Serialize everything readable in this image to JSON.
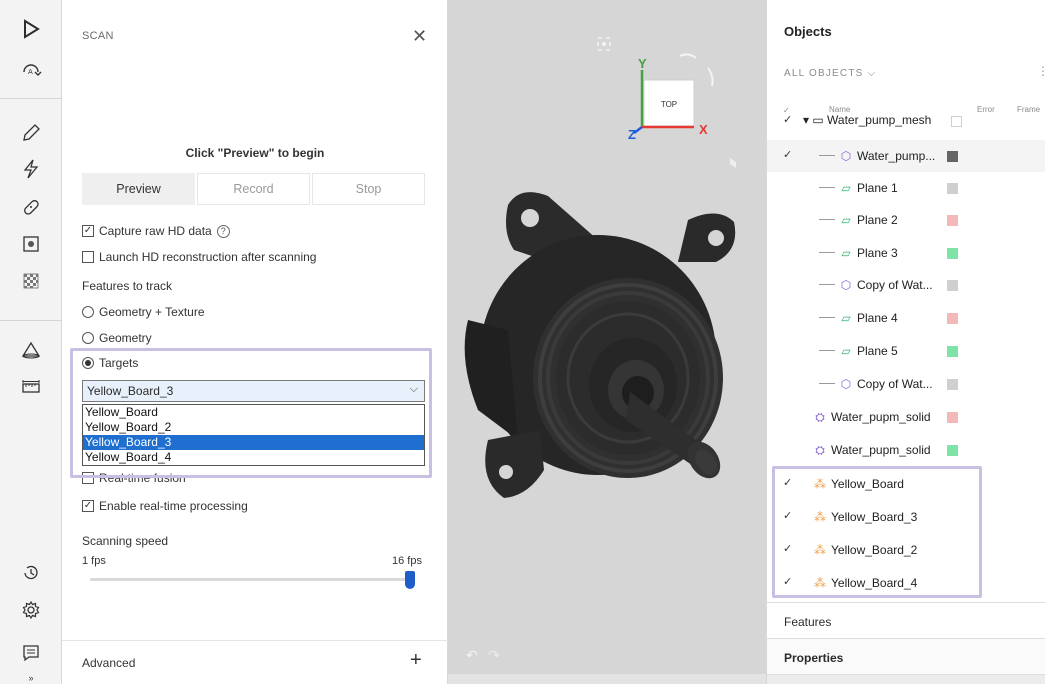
{
  "scan_panel": {
    "title": "SCAN",
    "hint": "Click \"Preview\" to begin",
    "tabs": [
      "Preview",
      "Record",
      "Stop"
    ],
    "capture_raw": "Capture raw HD data",
    "launch_hd": "Launch HD reconstruction after scanning",
    "features_label": "Features to track",
    "feature_options": [
      "Geometry + Texture",
      "Geometry",
      "Targets"
    ],
    "target_selected": "Yellow_Board_3",
    "target_options": [
      "Yellow_Board",
      "Yellow_Board_2",
      "Yellow_Board_3",
      "Yellow_Board_4"
    ],
    "realtime_fusion": "Real-time fusion",
    "realtime_processing": "Enable real-time processing",
    "speed_label": "Scanning speed",
    "speed_min": "1 fps",
    "speed_max": "16 fps",
    "speed_value_fraction": 1.0,
    "advanced": "Advanced"
  },
  "viewport": {
    "cube_face": "TOP",
    "axis_y": "Y",
    "axis_x": "X",
    "axis_z": "Z",
    "axis_colors": {
      "x": "#e53935",
      "y": "#43a047",
      "z": "#1e5fd6"
    }
  },
  "objects_panel": {
    "title": "Objects",
    "filter": "ALL OBJECTS",
    "columns": [
      "Name",
      "Error",
      "Frame"
    ],
    "rows": [
      {
        "name": "Water_pump_mesh",
        "checked": true,
        "color": "#ffffff"
      },
      {
        "name": "Water_pump...",
        "checked": true,
        "color": "#666666"
      },
      {
        "name": "Plane 1",
        "checked": false,
        "color": "#cfcfcf"
      },
      {
        "name": "Plane 2",
        "checked": false,
        "color": "#f3b8b8"
      },
      {
        "name": "Plane 3",
        "checked": false,
        "color": "#7fe3a7"
      },
      {
        "name": "Copy of Wat...",
        "checked": false,
        "color": "#cfcfcf"
      },
      {
        "name": "Plane 4",
        "checked": false,
        "color": "#f3b8b8"
      },
      {
        "name": "Plane 5",
        "checked": false,
        "color": "#7fe3a7"
      },
      {
        "name": "Copy of Wat...",
        "checked": false,
        "color": "#cfcfcf"
      },
      {
        "name": "Water_pupm_solid",
        "checked": false,
        "color": "#f3b8b8"
      },
      {
        "name": "Water_pupm_solid",
        "checked": false,
        "color": "#7fe3a7"
      },
      {
        "name": "Yellow_Board",
        "checked": true
      },
      {
        "name": "Yellow_Board_3",
        "checked": true
      },
      {
        "name": "Yellow_Board_2",
        "checked": true
      },
      {
        "name": "Yellow_Board_4",
        "checked": true
      }
    ],
    "sections": [
      "Features",
      "Properties"
    ]
  }
}
